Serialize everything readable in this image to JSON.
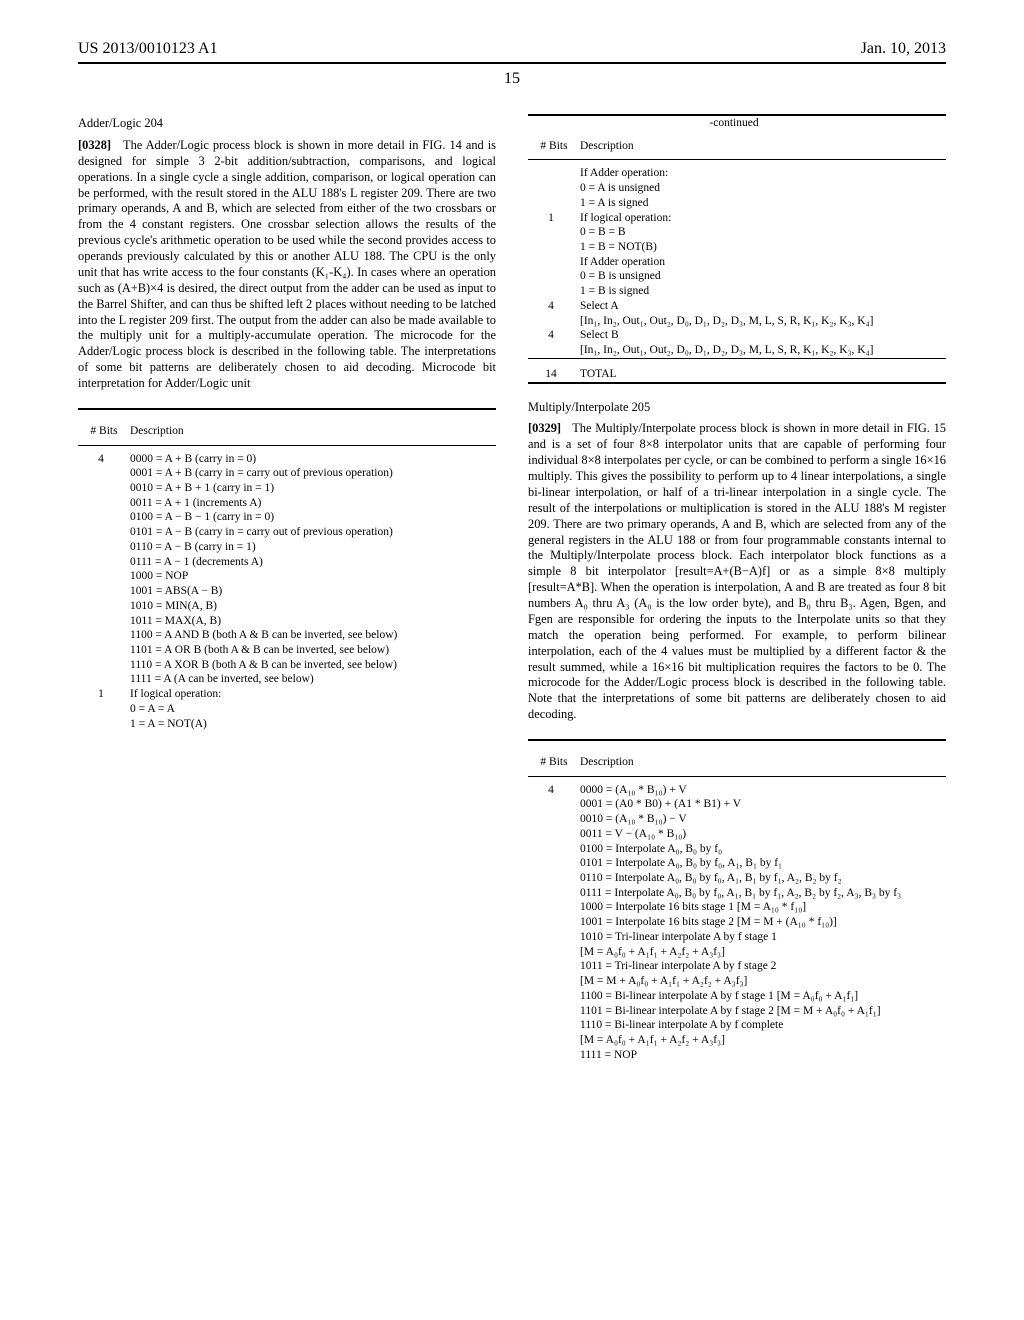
{
  "header": {
    "pub_number": "US 2013/0010123 A1",
    "date": "Jan. 10, 2013",
    "page": "15"
  },
  "left": {
    "section_title": "Adder/Logic 204",
    "para_num": "[0328]",
    "para_text": "The Adder/Logic process block is shown in more detail in FIG. 14 and is designed for simple 3 2-bit addition/subtraction, comparisons, and logical operations. In a single cycle a single addition, comparison, or logical operation can be performed, with the result stored in the ALU 188's L register 209. There are two primary operands, A and B, which are selected from either of the two crossbars or from the 4 constant registers. One crossbar selection allows the results of the previous cycle's arithmetic operation to be used while the second provides access to operands previously calculated by this or another ALU 188. The CPU is the only unit that has write access to the four constants (K₁-K₄). In cases where an operation such as (A+B)×4 is desired, the direct output from the adder can be used as input to the Barrel Shifter, and can thus be shifted left 2 places without needing to be latched into the L register 209 first. The output from the adder can also be made available to the multiply unit for a multiply-accumulate operation. The microcode for the Adder/Logic process block is described in the following table. The interpretations of some bit patterns are deliberately chosen to aid decoding. Microcode bit interpretation for Adder/Logic unit",
    "table1": {
      "hdr_bits": "# Bits",
      "hdr_desc": "Description",
      "rows": [
        {
          "bits": "4",
          "desc": "0000 = A + B (carry in = 0)"
        },
        {
          "bits": "",
          "desc": "0001 = A + B (carry in = carry out of previous operation)"
        },
        {
          "bits": "",
          "desc": "0010 = A + B + 1 (carry in = 1)"
        },
        {
          "bits": "",
          "desc": "0011 = A + 1 (increments A)"
        },
        {
          "bits": "",
          "desc": "0100 = A − B − 1 (carry in = 0)"
        },
        {
          "bits": "",
          "desc": "0101 = A − B (carry in = carry out of previous operation)"
        },
        {
          "bits": "",
          "desc": "0110 = A − B (carry in = 1)"
        },
        {
          "bits": "",
          "desc": "0111 = A − 1 (decrements A)"
        },
        {
          "bits": "",
          "desc": "1000 = NOP"
        },
        {
          "bits": "",
          "desc": "1001 = ABS(A − B)"
        },
        {
          "bits": "",
          "desc": "1010 = MIN(A, B)"
        },
        {
          "bits": "",
          "desc": "1011 = MAX(A, B)"
        },
        {
          "bits": "",
          "desc": "1100 = A AND B (both A & B can be inverted, see below)"
        },
        {
          "bits": "",
          "desc": "1101 = A OR B (both A & B can be inverted, see below)"
        },
        {
          "bits": "",
          "desc": "1110 = A XOR B (both A & B can be inverted, see below)"
        },
        {
          "bits": "",
          "desc": "1111 = A (A can be inverted, see below)"
        },
        {
          "bits": "1",
          "desc": "If logical operation:"
        },
        {
          "bits": "",
          "desc": "0 = A = A"
        },
        {
          "bits": "",
          "desc": "1 = A = NOT(A)"
        }
      ]
    }
  },
  "right": {
    "cont_label": "-continued",
    "table2": {
      "hdr_bits": "# Bits",
      "hdr_desc": "Description",
      "rows": [
        {
          "bits": "",
          "desc": "If Adder operation:"
        },
        {
          "bits": "",
          "desc": "0 = A is unsigned"
        },
        {
          "bits": "",
          "desc": "1 = A is signed"
        },
        {
          "bits": "1",
          "desc": "If logical operation:"
        },
        {
          "bits": "",
          "desc": "0 = B = B"
        },
        {
          "bits": "",
          "desc": "1 = B = NOT(B)"
        },
        {
          "bits": "",
          "desc": "If Adder operation"
        },
        {
          "bits": "",
          "desc": "0 = B is unsigned"
        },
        {
          "bits": "",
          "desc": "1 = B is signed"
        },
        {
          "bits": "4",
          "desc": "Select A"
        },
        {
          "bits": "",
          "desc": "[In₁, In₂, Out₁, Out₂, D₀, D₁, D₂, D₃, M, L, S, R, K₁, K₂, K₃, K₄]"
        },
        {
          "bits": "4",
          "desc": "Select B"
        },
        {
          "bits": "",
          "desc": "[In₁, In₂, Out₁, Out₂, D₀, D₁, D₂, D₃, M, L, S, R, K₁, K₂, K₃, K₄]"
        }
      ],
      "total_bits": "14",
      "total_label": "TOTAL"
    },
    "section_title": "Multiply/Interpolate 205",
    "para_num": "[0329]",
    "para_text": "The Multiply/Interpolate process block is shown in more detail in FIG. 15 and is a set of four 8×8 interpolator units that are capable of performing four individual 8×8 interpolates per cycle, or can be combined to perform a single 16×16 multiply. This gives the possibility to perform up to 4 linear interpolations, a single bi-linear interpolation, or half of a tri-linear interpolation in a single cycle. The result of the interpolations or multiplication is stored in the ALU 188's M register 209. There are two primary operands, A and B, which are selected from any of the general registers in the ALU 188 or from four programmable constants internal to the Multiply/Interpolate process block. Each interpolator block functions as a simple 8 bit interpolator [result=A+(B−A)f] or as a simple 8×8 multiply [result=A*B]. When the operation is interpolation, A and B are treated as four 8 bit numbers A₀ thru A₃ (A₀ is the low order byte), and B₀ thru B₃. Agen, Bgen, and Fgen are responsible for ordering the inputs to the Interpolate units so that they match the operation being performed. For example, to perform bilinear interpolation, each of the 4 values must be multiplied by a different factor & the result summed, while a 16×16 bit multiplication requires the factors to be 0. The microcode for the Adder/Logic process block is described in the following table. Note that the interpretations of some bit patterns are deliberately chosen to aid decoding.",
    "table3": {
      "hdr_bits": "# Bits",
      "hdr_desc": "Description",
      "rows": [
        {
          "bits": "4",
          "desc": "0000 = (A₁₀ * B₁₀) + V"
        },
        {
          "bits": "",
          "desc": "0001 = (A0 * B0) + (A1 * B1) + V"
        },
        {
          "bits": "",
          "desc": "0010 = (A₁₀ * B₁₀) − V"
        },
        {
          "bits": "",
          "desc": "0011 = V − (A₁₀ * B₁₀)"
        },
        {
          "bits": "",
          "desc": "0100 = Interpolate A₀, B₀ by f₀"
        },
        {
          "bits": "",
          "desc": "0101 = Interpolate A₀, B₀ by f₀, A₁, B₁ by f₁"
        },
        {
          "bits": "",
          "desc": "0110 = Interpolate A₀, B₀ by f₀, A₁, B₁ by f₁, A₂, B₂ by f₂"
        },
        {
          "bits": "",
          "desc": "0111 = Interpolate A₀, B₀ by f₀, A₁, B₁ by f₁, A₂, B₂ by f₂, A₃, B₃ by f₃"
        },
        {
          "bits": "",
          "desc": "1000 = Interpolate 16 bits stage 1 [M = A₁₀ * f₁₀]"
        },
        {
          "bits": "",
          "desc": "1001 = Interpolate 16 bits stage 2 [M = M + (A₁₀ * f₁₀)]"
        },
        {
          "bits": "",
          "desc": "1010 = Tri-linear interpolate A by f stage 1"
        },
        {
          "bits": "",
          "desc": "[M = A₀f₀ + A₁f₁ + A₂f₂ + A₃f₃]"
        },
        {
          "bits": "",
          "desc": "1011 = Tri-linear interpolate A by f stage 2"
        },
        {
          "bits": "",
          "desc": "[M = M + A₀f₀ + A₁f₁ + A₂f₂ + A₃f₃]"
        },
        {
          "bits": "",
          "desc": "1100 = Bi-linear interpolate A by f stage 1 [M = A₀f₀ + A₁f₁]"
        },
        {
          "bits": "",
          "desc": "1101 = Bi-linear interpolate A by f stage 2 [M = M + A₀f₀ + A₁f₁]"
        },
        {
          "bits": "",
          "desc": "1110 = Bi-linear interpolate A by f complete"
        },
        {
          "bits": "",
          "desc": "[M = A₀f₀ + A₁f₁ + A₂f₂ + A₃f₃]"
        },
        {
          "bits": "",
          "desc": "1111 = NOP"
        }
      ]
    }
  }
}
